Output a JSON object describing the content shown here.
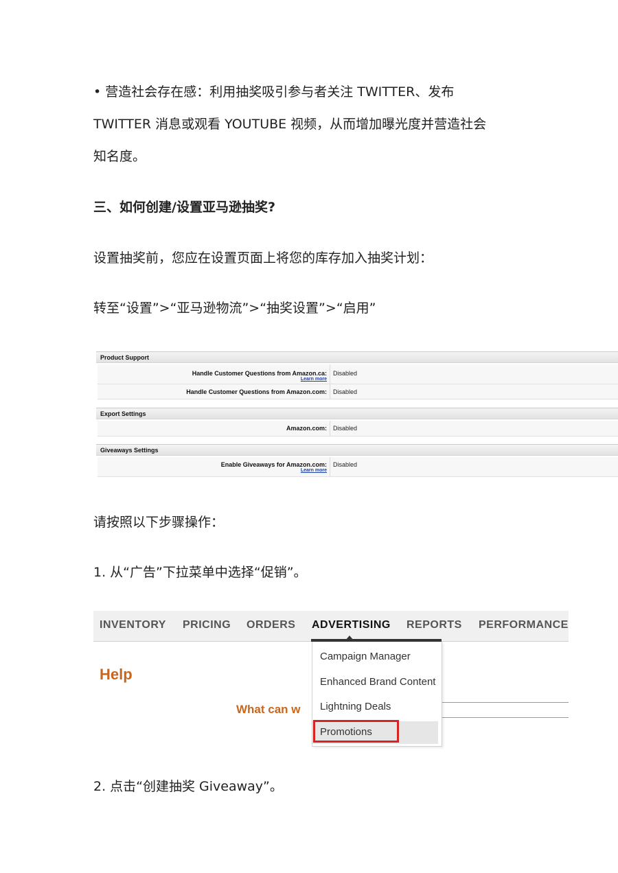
{
  "paragraphs": {
    "p1_line1": "• 营造社会存在感：利用抽奖吸引参与者关注 TWITTER、发布",
    "p1_line2": "TWITTER 消息或观看 YOUTUBE 视频，从而增加曝光度并营造社会",
    "p1_line3": "知名度。",
    "heading3": "三、如何创建/设置亚马逊抽奖?",
    "p2": "设置抽奖前，您应在设置页面上将您的库存加入抽奖计划：",
    "p3": "转至“设置”>“亚马逊物流”>“抽奖设置”>“启用”",
    "p4": "请按照以下步骤操作：",
    "step1": "1. 从“广告”下拉菜单中选择“促销”。",
    "step2": "2. 点击“创建抽奖 Giveaway”。"
  },
  "settings_screenshot": {
    "sections": [
      {
        "title": "Product Support",
        "rows": [
          {
            "label": "Handle Customer Questions from Amazon.ca:",
            "value": "Disabled",
            "link": "Learn more"
          },
          {
            "label": "Handle Customer Questions from Amazon.com:",
            "value": "Disabled"
          }
        ]
      },
      {
        "title": "Export Settings",
        "rows": [
          {
            "label": "Amazon.com:",
            "value": "Disabled"
          }
        ]
      },
      {
        "title": "Giveaways Settings",
        "rows": [
          {
            "label": "Enable Giveaways for Amazon.com:",
            "value": "Disabled",
            "link": "Learn more"
          }
        ]
      }
    ]
  },
  "nav_screenshot": {
    "tabs": [
      "INVENTORY",
      "PRICING",
      "ORDERS",
      "ADVERTISING",
      "REPORTS",
      "PERFORMANCE"
    ],
    "active_tab": "ADVERTISING",
    "help_title": "Help",
    "partial_heading": "What can w",
    "dropdown_items": [
      "Campaign Manager",
      "Enhanced Brand Content",
      "Lightning Deals",
      "Promotions"
    ],
    "highlighted_item": "Promotions",
    "colors": {
      "help_orange": "#c7661f",
      "highlight_red": "#d62323"
    }
  }
}
